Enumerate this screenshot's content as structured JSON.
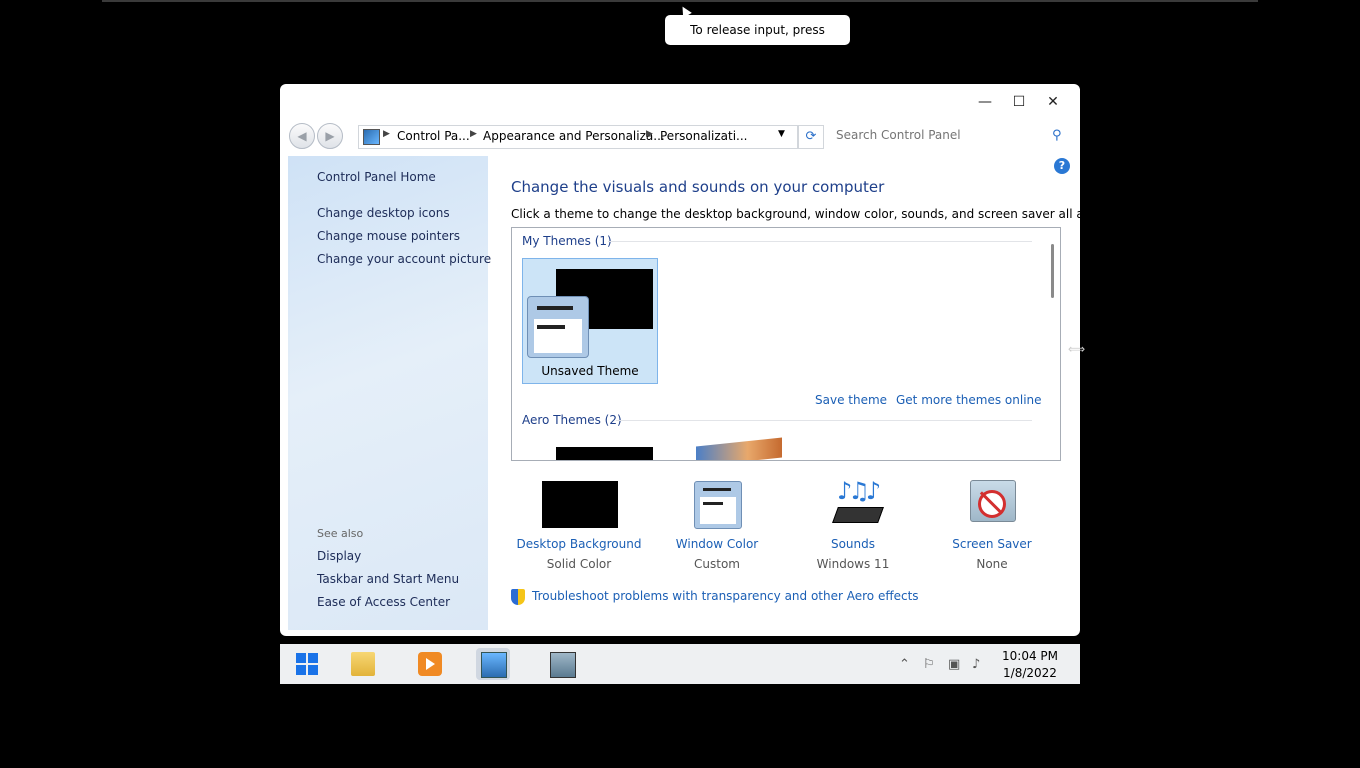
{
  "vm": {
    "tooltip": "To release input, press Ctrl+Alt."
  },
  "window": {
    "controls": {
      "minimize": "—",
      "maximize": "☐",
      "close": "✕"
    },
    "nav": {
      "back": "◀",
      "forward": "▶"
    },
    "address": {
      "crumbs": [
        "Control Pa...",
        "Appearance and Personaliza...",
        "Personalizati..."
      ],
      "separator": "▶"
    },
    "search": {
      "placeholder": "Search Control Panel"
    },
    "help": "?"
  },
  "sidebar": {
    "home": "Control Panel Home",
    "links": [
      "Change desktop icons",
      "Change mouse pointers",
      "Change your account picture"
    ],
    "see_also_title": "See also",
    "see_also": [
      "Display",
      "Taskbar and Start Menu",
      "Ease of Access Center"
    ]
  },
  "main": {
    "title": "Change the visuals and sounds on your computer",
    "subtitle": "Click a theme to change the desktop background, window color, sounds, and screen saver all at once.",
    "my_themes_title": "My Themes (1)",
    "selected_theme": "Unsaved Theme",
    "save_theme": "Save theme",
    "get_more": "Get more themes online",
    "aero_themes_title": "Aero Themes (2)",
    "settings": [
      {
        "label": "Desktop Background",
        "value": "Solid Color",
        "icon": "desktop-background-icon"
      },
      {
        "label": "Window Color",
        "value": "Custom",
        "icon": "window-color-icon"
      },
      {
        "label": "Sounds",
        "value": "Windows 11",
        "icon": "sounds-icon"
      },
      {
        "label": "Screen Saver",
        "value": "None",
        "icon": "screen-saver-icon"
      }
    ],
    "troubleshoot": "Troubleshoot problems with transparency and other Aero effects"
  },
  "taskbar": {
    "clock_time": "10:04 PM",
    "clock_date": "1/8/2022"
  }
}
